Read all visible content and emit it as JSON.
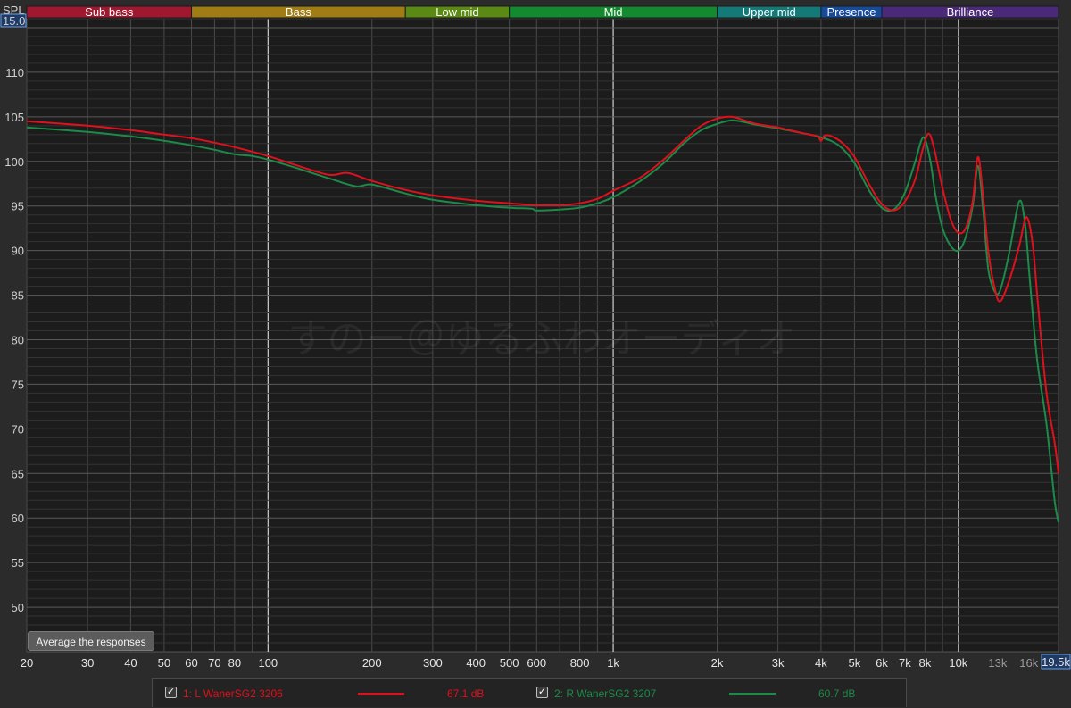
{
  "y_axis_label": "SPL",
  "y_top_value": "15.0",
  "x_right_value": "19.5k",
  "watermark": "すのー＠ゆるふわオーディオ",
  "average_button_label": "Average the responses",
  "bands": [
    {
      "label": "Sub bass",
      "from": 20,
      "to": 60,
      "color": "#a01830"
    },
    {
      "label": "Bass",
      "from": 60,
      "to": 250,
      "color": "#a07c14"
    },
    {
      "label": "Low mid",
      "from": 250,
      "to": 500,
      "color": "#5a8a14"
    },
    {
      "label": "Mid",
      "from": 500,
      "to": 2000,
      "color": "#148a30"
    },
    {
      "label": "Upper mid",
      "from": 2000,
      "to": 4000,
      "color": "#147a78"
    },
    {
      "label": "Presence",
      "from": 4000,
      "to": 6000,
      "color": "#184a9a"
    },
    {
      "label": "Brilliance",
      "from": 6000,
      "to": 19500,
      "color": "#4a2a78"
    }
  ],
  "legend": [
    {
      "check": "✓",
      "name": "1: L WanerSG2 3206",
      "value": "67.1 dB",
      "color": "#e0101c"
    },
    {
      "check": "✓",
      "name": "2: R WanerSG2 3207",
      "value": "60.7 dB",
      "color": "#1c8a48"
    }
  ],
  "chart_data": {
    "type": "line",
    "x_scale": "log",
    "xlim": [
      20,
      19500
    ],
    "ylim": [
      45,
      116
    ],
    "ylabel": "SPL",
    "grid": true,
    "y_ticks": [
      50,
      55,
      60,
      65,
      70,
      75,
      80,
      85,
      90,
      95,
      100,
      105,
      110
    ],
    "x_ticks": [
      {
        "value": 20,
        "label": "20",
        "minor": false
      },
      {
        "value": 30,
        "label": "30",
        "minor": false
      },
      {
        "value": 40,
        "label": "40",
        "minor": false
      },
      {
        "value": 50,
        "label": "50",
        "minor": false
      },
      {
        "value": 60,
        "label": "60",
        "minor": false
      },
      {
        "value": 70,
        "label": "70",
        "minor": false
      },
      {
        "value": 80,
        "label": "80",
        "minor": false
      },
      {
        "value": 100,
        "label": "100",
        "minor": false
      },
      {
        "value": 200,
        "label": "200",
        "minor": false
      },
      {
        "value": 300,
        "label": "300",
        "minor": false
      },
      {
        "value": 400,
        "label": "400",
        "minor": false
      },
      {
        "value": 500,
        "label": "500",
        "minor": false
      },
      {
        "value": 600,
        "label": "600",
        "minor": false
      },
      {
        "value": 800,
        "label": "800",
        "minor": false
      },
      {
        "value": 1000,
        "label": "1k",
        "minor": false
      },
      {
        "value": 2000,
        "label": "2k",
        "minor": false
      },
      {
        "value": 3000,
        "label": "3k",
        "minor": false
      },
      {
        "value": 4000,
        "label": "4k",
        "minor": false
      },
      {
        "value": 5000,
        "label": "5k",
        "minor": false
      },
      {
        "value": 6000,
        "label": "6k",
        "minor": false
      },
      {
        "value": 7000,
        "label": "7k",
        "minor": false
      },
      {
        "value": 8000,
        "label": "8k",
        "minor": false
      },
      {
        "value": 10000,
        "label": "10k",
        "minor": false
      },
      {
        "value": 13000,
        "label": "13k",
        "minor": true
      },
      {
        "value": 16000,
        "label": "16k",
        "minor": true
      }
    ],
    "series": [
      {
        "name": "1: L WanerSG2 3206",
        "color": "#e0101c",
        "x": [
          20,
          30,
          40,
          50,
          60,
          70,
          80,
          100,
          120,
          150,
          170,
          200,
          250,
          300,
          400,
          500,
          600,
          700,
          800,
          900,
          1000,
          1200,
          1400,
          1600,
          1800,
          2000,
          2200,
          2400,
          2600,
          3000,
          3500,
          3900,
          4000,
          4100,
          4300,
          4600,
          5000,
          5500,
          6000,
          6500,
          7000,
          7500,
          7900,
          8200,
          8500,
          9000,
          9500,
          10000,
          10500,
          11000,
          11400,
          11800,
          12200,
          12700,
          13200,
          14000,
          15000,
          15600,
          16000,
          16500,
          17000,
          18000,
          19000,
          19500
        ],
        "y": [
          104.5,
          104.0,
          103.5,
          103.0,
          102.6,
          102.1,
          101.6,
          100.6,
          99.6,
          98.5,
          98.7,
          97.8,
          96.8,
          96.2,
          95.6,
          95.3,
          95.1,
          95.1,
          95.3,
          95.8,
          96.7,
          98.2,
          100.2,
          102.3,
          104.0,
          104.8,
          105.0,
          104.6,
          104.2,
          103.8,
          103.2,
          102.8,
          102.3,
          102.9,
          102.8,
          102.1,
          100.5,
          97.5,
          95.2,
          94.5,
          95.5,
          98.0,
          101.5,
          103.1,
          101.5,
          97.0,
          93.5,
          92.0,
          92.5,
          95.5,
          100.5,
          96.0,
          90.0,
          86.0,
          84.3,
          86.5,
          90.5,
          93.5,
          93.2,
          90.0,
          84.0,
          74.0,
          68.5,
          65.0
        ]
      },
      {
        "name": "2: R WanerSG2 3207",
        "color": "#1c8a48",
        "x": [
          20,
          30,
          40,
          50,
          60,
          70,
          80,
          90,
          100,
          120,
          150,
          180,
          200,
          250,
          300,
          400,
          500,
          580,
          600,
          700,
          800,
          900,
          1000,
          1200,
          1400,
          1600,
          1800,
          2000,
          2200,
          2400,
          2600,
          3000,
          3500,
          4000,
          4500,
          5000,
          5500,
          6000,
          6500,
          7000,
          7500,
          7800,
          8000,
          8300,
          8600,
          9000,
          9500,
          10000,
          10500,
          11000,
          11400,
          11800,
          12200,
          12700,
          13200,
          14000,
          15000,
          15600,
          16000,
          16500,
          17000,
          18000,
          19000,
          19500
        ],
        "y": [
          103.8,
          103.3,
          102.8,
          102.3,
          101.8,
          101.3,
          100.8,
          100.6,
          100.2,
          99.3,
          98.1,
          97.2,
          97.4,
          96.4,
          95.7,
          95.1,
          94.8,
          94.7,
          94.5,
          94.6,
          94.8,
          95.3,
          96.0,
          97.8,
          99.8,
          102.0,
          103.5,
          104.2,
          104.6,
          104.4,
          104.1,
          103.7,
          103.2,
          102.7,
          101.8,
          99.8,
          96.8,
          94.8,
          94.6,
          96.5,
          100.0,
          102.3,
          102.5,
          100.0,
          96.0,
          92.5,
          90.5,
          90.0,
          91.5,
          95.0,
          99.5,
          94.5,
          88.0,
          85.5,
          85.5,
          89.5,
          95.5,
          93.0,
          88.0,
          82.0,
          77.0,
          70.5,
          62.0,
          59.5
        ]
      }
    ]
  }
}
